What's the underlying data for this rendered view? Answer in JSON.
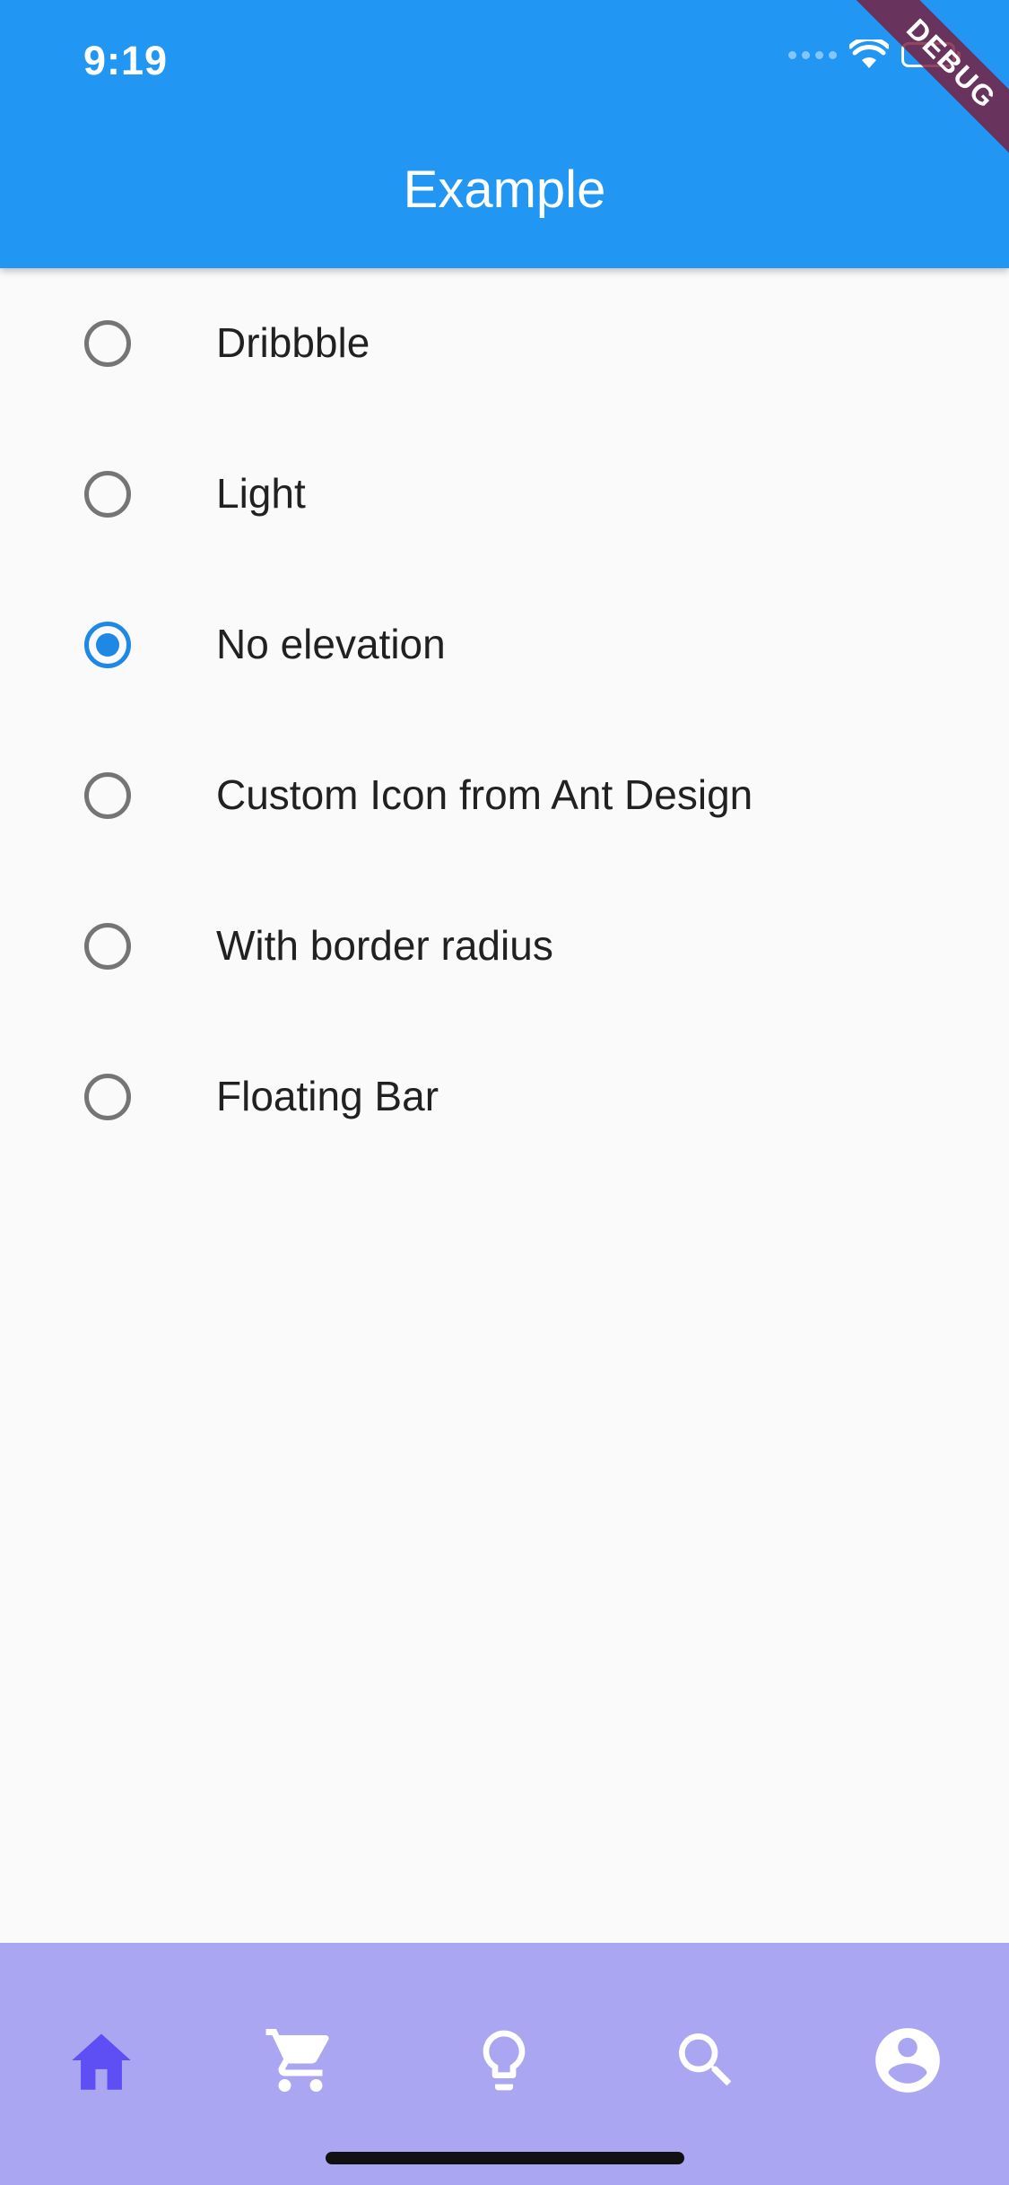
{
  "status_bar": {
    "time": "9:19"
  },
  "app_bar": {
    "title": "Example",
    "background_color": "#2196f3"
  },
  "debug_banner": {
    "label": "DEBUG"
  },
  "radio_options": [
    {
      "label": "Dribbble",
      "selected": false
    },
    {
      "label": "Light",
      "selected": false
    },
    {
      "label": "No elevation",
      "selected": true
    },
    {
      "label": "Custom Icon from Ant Design",
      "selected": false
    },
    {
      "label": "With border radius",
      "selected": false
    },
    {
      "label": "Floating Bar",
      "selected": false
    }
  ],
  "bottom_nav": {
    "background_color": "#aba6f2",
    "active_color": "#5d4ff4",
    "inactive_color": "#ffffff",
    "items": [
      {
        "icon": "home-icon",
        "active": true
      },
      {
        "icon": "cart-icon",
        "active": false
      },
      {
        "icon": "lightbulb-icon",
        "active": false
      },
      {
        "icon": "search-icon",
        "active": false
      },
      {
        "icon": "account-icon",
        "active": false
      }
    ]
  }
}
